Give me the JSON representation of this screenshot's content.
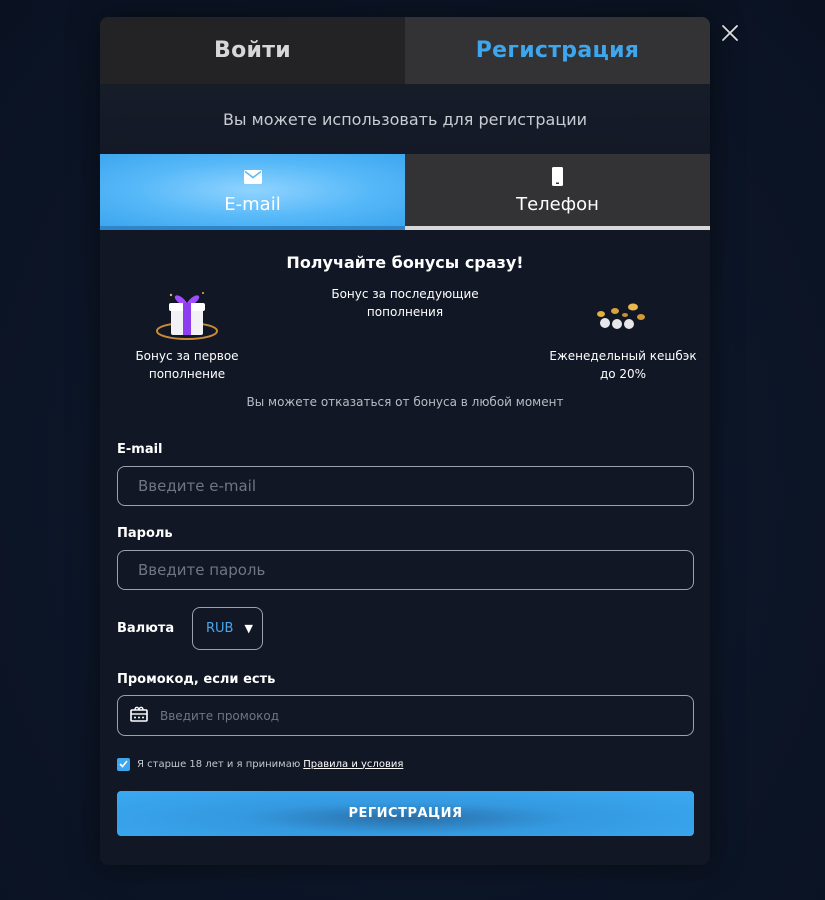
{
  "header": {
    "tabs": [
      {
        "label": "Войти",
        "active": false
      },
      {
        "label": "Регистрация",
        "active": true
      }
    ],
    "accent_color": "#3ea6ec"
  },
  "subtitle": "Вы можете использовать для регистрации",
  "methods": [
    {
      "label": "E-mail",
      "icon": "envelope-icon",
      "active": true
    },
    {
      "label": "Телефон",
      "icon": "phone-icon",
      "active": false
    }
  ],
  "bonuses": {
    "title": "Получайте бонусы сразу!",
    "items": [
      {
        "label": "Бонус за первое пополнение",
        "icon": "gift-icon"
      },
      {
        "label": "Бонус за последующие пополнения",
        "icon": ""
      },
      {
        "label": "Еженедельный кешбэк до 20%",
        "icon": "coins-icon"
      }
    ],
    "note": "Вы можете отказаться от бонуса в любой момент"
  },
  "form": {
    "email_label": "E-mail",
    "email_placeholder": "Введите e-mail",
    "password_label": "Пароль",
    "password_placeholder": "Введите пароль",
    "currency_label": "Валюта",
    "currency_value": "RUB",
    "promo_label": "Промокод, если есть",
    "promo_placeholder": "Введите промокод",
    "terms_text": "Я старше 18 лет и я принимаю",
    "terms_link": "Правила и условия",
    "terms_checked": true,
    "submit_label": "РЕГИСТРАЦИЯ"
  }
}
